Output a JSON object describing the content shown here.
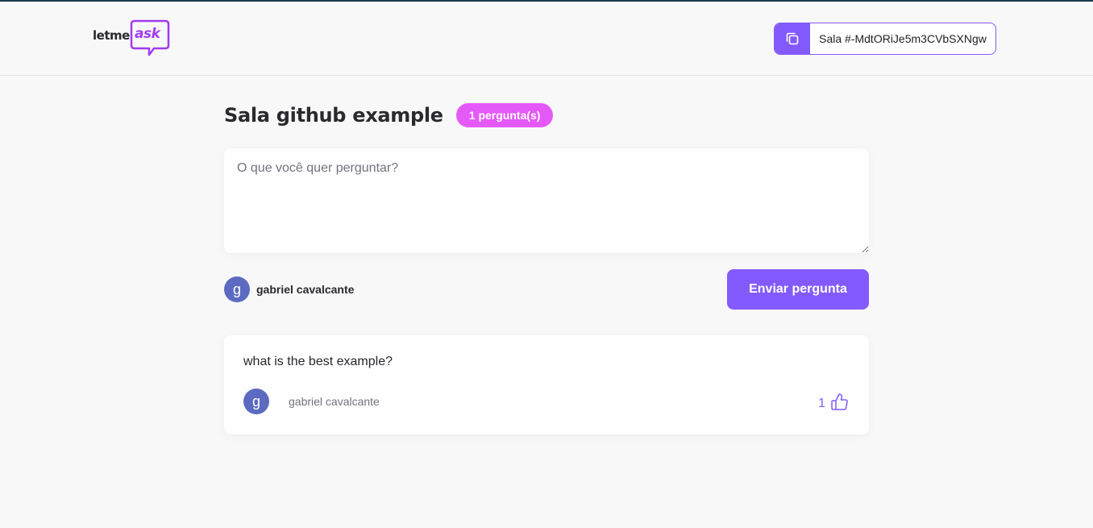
{
  "header": {
    "logo": {
      "word1": "letme",
      "word2": "ask"
    },
    "room_code": {
      "label": "Sala #-MdtORiJe5m3CVbSXNgw",
      "icon": "copy-icon"
    }
  },
  "room": {
    "title": "Sala github example",
    "badge": "1 pergunta(s)"
  },
  "form": {
    "placeholder": "O que você quer perguntar?",
    "value": "",
    "user": {
      "avatar_letter": "g",
      "name": "gabriel cavalcante"
    },
    "submit_label": "Enviar pergunta"
  },
  "questions": [
    {
      "content": "what is the best example?",
      "author": {
        "avatar_letter": "g",
        "name": "gabriel cavalcante"
      },
      "like_count": "1",
      "like_icon": "thumbs-up-icon"
    }
  ],
  "colors": {
    "primary": "#835afd",
    "badge": "#e559f9",
    "background": "#f8f8f8",
    "avatar": "#5c6bc0"
  }
}
